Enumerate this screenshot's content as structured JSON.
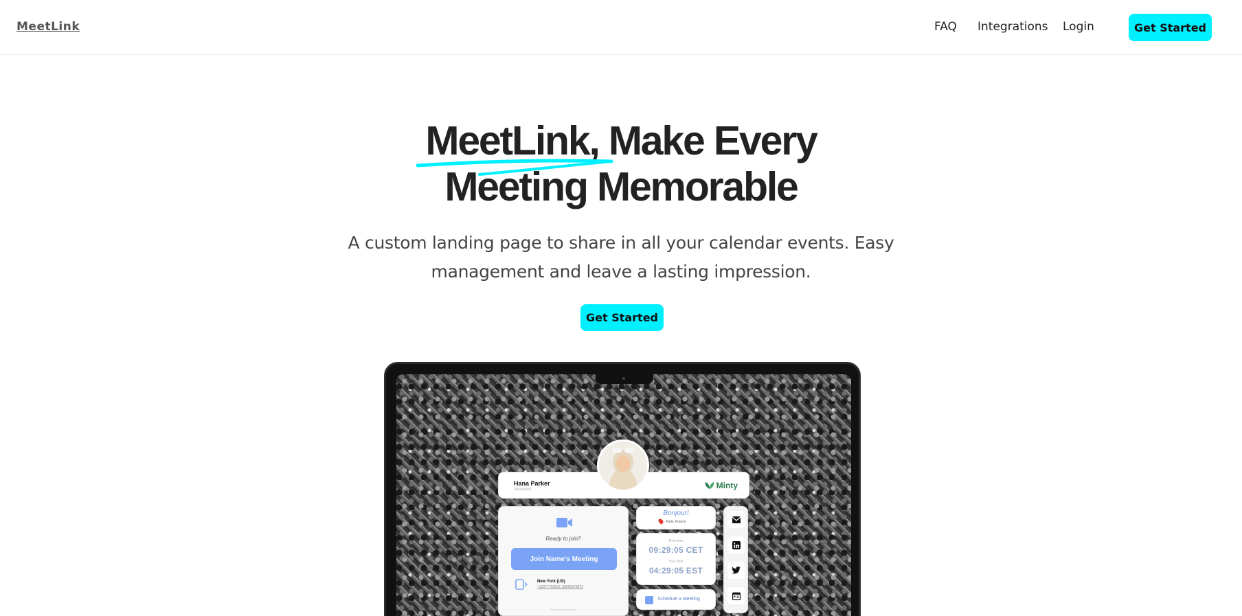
{
  "header": {
    "logo": "MeetLink",
    "nav": {
      "faq": "FAQ",
      "integrations": "Integrations",
      "login": "Login"
    },
    "cta": "Get Started"
  },
  "hero": {
    "title_line1": "MeetLink, Make Every",
    "title_line2": "Meeting Memorable",
    "subtitle": "A custom landing page to share in all your calendar events. Easy management and leave a lasting impression.",
    "cta": "Get Started"
  },
  "mockup": {
    "profile": {
      "name": "Hana Parker",
      "role": "Journalist",
      "brand": "Minty"
    },
    "join": {
      "ready": "Ready to join?",
      "button": "Join Name's Meeting",
      "dial_location": "New York (US)",
      "dial_number": "+12077709500, 6856087987#",
      "powered": "Powered by MeetLink"
    },
    "greeting": {
      "text": "Bonjour!",
      "location": "Paris, France"
    },
    "times": {
      "their_label": "Their time",
      "their_time": "09:29:05 CET",
      "your_label": "Your time",
      "your_time": "04:29:05 EST"
    },
    "schedule": "Schedule a Meeting",
    "social_icons": [
      "mail-icon",
      "linkedin-icon",
      "twitter-icon",
      "calendar-icon"
    ]
  },
  "colors": {
    "accent": "#00f0ff",
    "join_button": "#7aa3f5",
    "brand_green": "#2e7d4f"
  }
}
